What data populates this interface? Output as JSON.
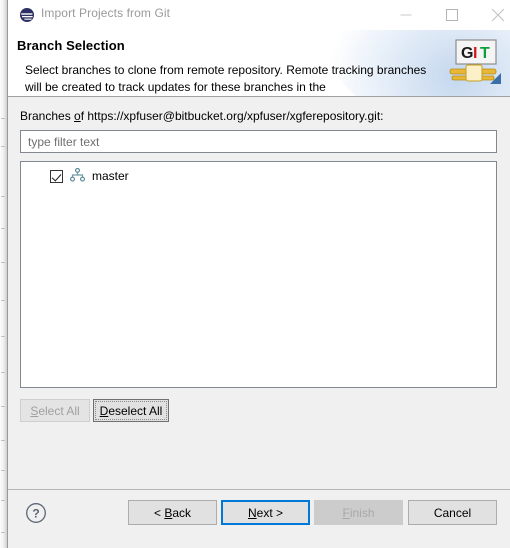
{
  "window": {
    "title": "Import Projects from Git",
    "icon": "eclipse-icon",
    "controls": {
      "minimize": "minimize-icon",
      "maximize": "maximize-icon",
      "close": "close-icon"
    }
  },
  "header": {
    "title": "Branch Selection",
    "description": "Select branches to clone from remote repository. Remote tracking branches will be created to track updates for these branches in the",
    "logo": {
      "name": "git-logo-icon",
      "text_g": "G",
      "text_i": "I",
      "text_t": "T",
      "color_g": "#1a1a1a",
      "color_i": "#d01a1a",
      "color_t": "#0d9e3c",
      "pipe_color": "#e8b735"
    },
    "accent_color": "#b0cae8"
  },
  "main": {
    "branches_label_prefix": "Branches ",
    "branches_label_mnemonic": "o",
    "branches_label_suffix": "f https://xpfuser@bitbucket.org/xpfuser/xgferepository.git:",
    "filter": {
      "value": "",
      "placeholder": "type filter text"
    },
    "tree": {
      "items": [
        {
          "label": "master",
          "checked": true,
          "icon": "git-branch-icon"
        }
      ]
    },
    "buttons": {
      "select_all": {
        "prefix": "",
        "mnemonic": "S",
        "suffix": "elect All",
        "enabled": false
      },
      "deselect_all": {
        "prefix": "",
        "mnemonic": "D",
        "suffix": "eselect All",
        "enabled": true,
        "focused": true
      }
    }
  },
  "footer": {
    "help_icon": "help-icon",
    "buttons": {
      "back": {
        "prefix": "< ",
        "mnemonic": "B",
        "suffix": "ack",
        "enabled": true
      },
      "next": {
        "prefix": "",
        "mnemonic": "N",
        "suffix": "ext >",
        "enabled": true,
        "focused": true,
        "focus_color": "#0078d7"
      },
      "finish": {
        "prefix": "",
        "mnemonic": "F",
        "suffix": "inish",
        "enabled": false
      },
      "cancel": {
        "prefix": "",
        "mnemonic": "",
        "suffix": "Cancel",
        "enabled": true
      }
    }
  }
}
